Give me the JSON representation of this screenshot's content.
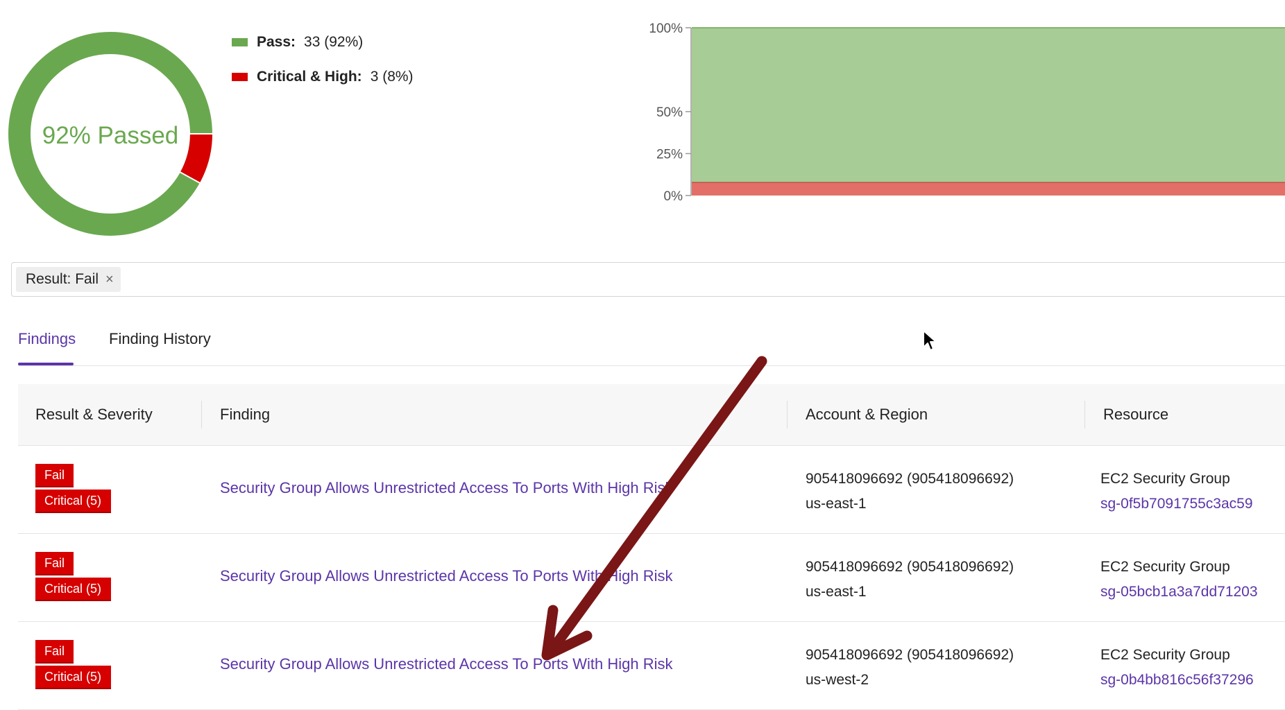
{
  "summary": {
    "donut_label": "92% Passed",
    "pass_fraction": 0.92,
    "colors": {
      "pass": "#6aa84f",
      "fail": "#d60000"
    },
    "legend": [
      {
        "name": "Pass:",
        "value": "33 (92%)",
        "color": "#6aa84f"
      },
      {
        "name": "Critical & High:",
        "value": "3 (8%)",
        "color": "#d60000"
      }
    ]
  },
  "trend_chart": {
    "type": "area",
    "y_ticks": [
      "100%",
      "50%",
      "25%",
      "0%"
    ],
    "y_tick_values": [
      100,
      50,
      25,
      0
    ],
    "ylim": [
      0,
      100
    ],
    "series": [
      {
        "name": "Critical & High",
        "values": [
          8,
          8
        ],
        "color": "#e27069"
      },
      {
        "name": "Pass",
        "values": [
          92,
          92
        ],
        "color": "#a8cc95"
      }
    ]
  },
  "filter": {
    "chip_label": "Result: Fail",
    "remove_glyph": "×"
  },
  "tabs": [
    {
      "label": "Findings",
      "active": true
    },
    {
      "label": "Finding History",
      "active": false
    }
  ],
  "table": {
    "columns": [
      "Result & Severity",
      "Finding",
      "Account & Region",
      "Resource"
    ],
    "rows": [
      {
        "result": "Fail",
        "severity": "Critical (5)",
        "finding": "Security Group Allows Unrestricted Access To Ports With High Risk",
        "account": "905418096692 (905418096692)",
        "region": "us-east-1",
        "resource_type": "EC2 Security Group",
        "resource_id": "sg-0f5b7091755c3ac59"
      },
      {
        "result": "Fail",
        "severity": "Critical (5)",
        "finding": "Security Group Allows Unrestricted Access To Ports With High Risk",
        "account": "905418096692 (905418096692)",
        "region": "us-east-1",
        "resource_type": "EC2 Security Group",
        "resource_id": "sg-05bcb1a3a7dd71203"
      },
      {
        "result": "Fail",
        "severity": "Critical (5)",
        "finding": "Security Group Allows Unrestricted Access To Ports With High Risk",
        "account": "905418096692 (905418096692)",
        "region": "us-west-2",
        "resource_type": "EC2 Security Group",
        "resource_id": "sg-0b4bb816c56f37296"
      }
    ]
  },
  "annotation": {
    "arrow_color": "#7a1616",
    "icon": "arrow-annotation-icon"
  },
  "cursor": {
    "icon": "mouse-pointer-icon"
  }
}
